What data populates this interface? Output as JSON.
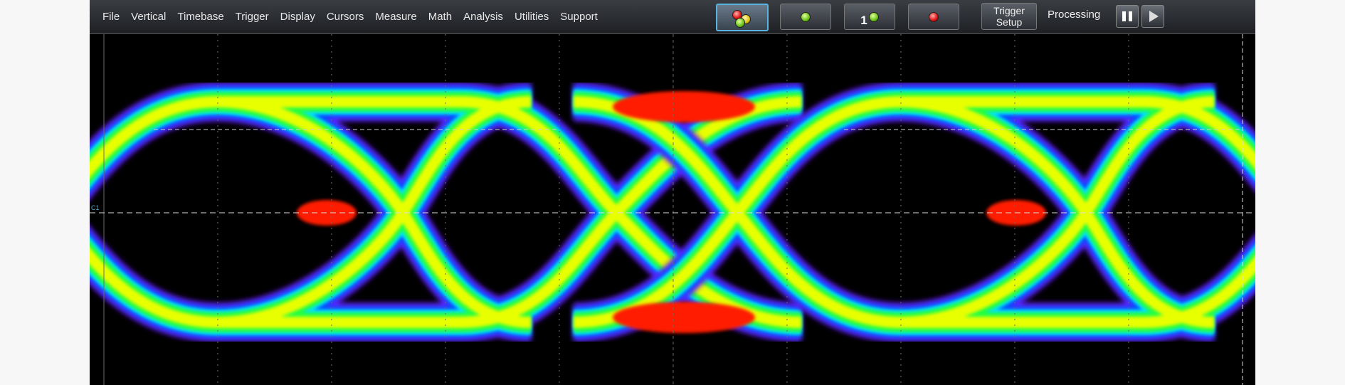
{
  "menu": {
    "items": [
      "File",
      "Vertical",
      "Timebase",
      "Trigger",
      "Display",
      "Cursors",
      "Measure",
      "Math",
      "Analysis",
      "Utilities",
      "Support"
    ]
  },
  "toolbar": {
    "trace_number": "1",
    "trigger_setup_line1": "Trigger",
    "trigger_setup_line2": "Setup",
    "status": "Processing"
  },
  "display": {
    "channel_marker": "C1",
    "colors": {
      "background": "#000000",
      "low": "#6a1cff",
      "mid_low": "#0050ff",
      "mid": "#00e0ff",
      "mid_high": "#20ff40",
      "high": "#e8ff00",
      "peak": "#ff1a00"
    }
  }
}
